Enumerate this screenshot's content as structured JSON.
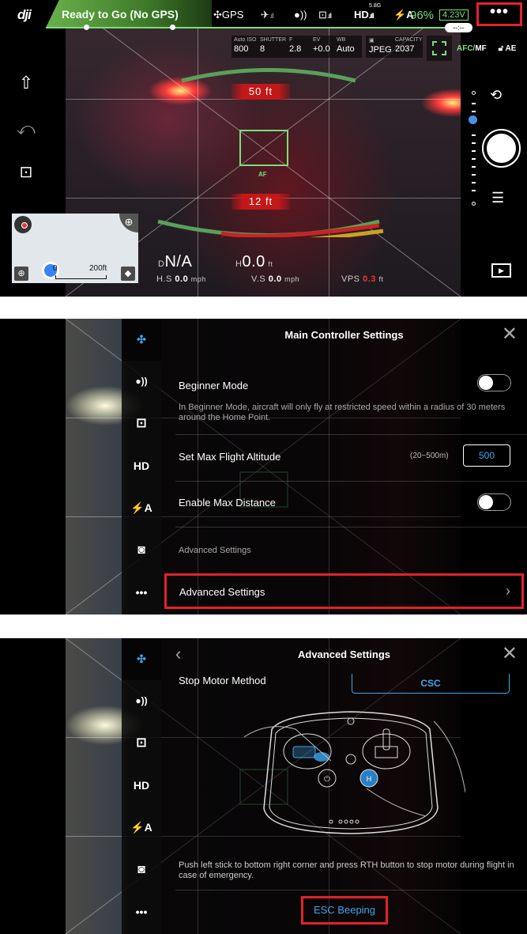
{
  "screen1": {
    "logo": "dji",
    "status": "Ready to Go (No GPS)",
    "gps_label": "GPS",
    "hd_label": "HD",
    "hd_band": "5.8G",
    "battery_percent": "96%",
    "voltage": "4.23V",
    "more_label": "•••",
    "timer": "--:--",
    "camera_params": [
      {
        "label": "Auto ISO",
        "value": "800"
      },
      {
        "label": "SHUTTER",
        "value": "8"
      },
      {
        "label": "F",
        "value": "2.8"
      },
      {
        "label": "EV",
        "value": "+0.0"
      },
      {
        "label": "WB",
        "value": "Auto"
      }
    ],
    "format": {
      "label": "",
      "value": "JPEG"
    },
    "capacity": {
      "label": "CAPACITY",
      "value": "2037"
    },
    "afc_label_green": "AFC/",
    "afc_label_white": "MF",
    "ae_label": "AE",
    "altitude_upper": "50 ft",
    "altitude_lower": "12 ft",
    "af_label": "AF",
    "map": {
      "scale_start": "0",
      "scale_end": "200ft"
    },
    "telemetry": {
      "d_label": "D",
      "d_value": "N/A",
      "h_label": "H",
      "h_value": "0.0",
      "h_unit": "ft",
      "hs_label": "H.S",
      "hs_value": "0.0",
      "hs_unit": "mph",
      "vs_label": "V.S",
      "vs_value": "0.0",
      "vs_unit": "mph",
      "vps_label": "VPS",
      "vps_value": "0.3",
      "vps_unit": "ft"
    }
  },
  "screen2": {
    "title": "Main Controller Settings",
    "sidebar": [
      {
        "icon": "aircraft-icon",
        "glyph": "✣"
      },
      {
        "icon": "signal-icon",
        "glyph": "●))"
      },
      {
        "icon": "remote-controller-icon",
        "glyph": "⊡"
      },
      {
        "icon": "hd-icon",
        "glyph": "HD"
      },
      {
        "icon": "battery-icon",
        "glyph": "⚡A"
      },
      {
        "icon": "camera-icon",
        "glyph": "◙"
      },
      {
        "icon": "more-icon",
        "glyph": "•••"
      }
    ],
    "beginner_mode_label": "Beginner Mode",
    "beginner_mode_on": false,
    "beginner_mode_desc": "In Beginner Mode, aircraft will only fly at restricted speed within a radius of 30 meters around the Home Point.",
    "max_altitude_label": "Set Max Flight Altitude",
    "max_altitude_range": "(20~500m)",
    "max_altitude_value": "500",
    "max_distance_label": "Enable Max Distance",
    "max_distance_on": false,
    "section_header": "Advanced Settings",
    "advanced_row_label": "Advanced Settings",
    "chevron": "›"
  },
  "screen3": {
    "title": "Advanced Settings",
    "back": "‹",
    "stop_motor_label": "Stop Motor Method",
    "stop_motor_value": "CSC",
    "stop_motor_desc": "Push left stick to bottom right corner and press RTH button to stop motor during flight in case of emergency.",
    "esc_beeping_label": "ESC Beeping"
  },
  "colors": {
    "accent_blue": "#3ea7f0",
    "status_green": "#7ae07a",
    "highlight_red": "#e3222a",
    "altitude_red": "#c41818"
  }
}
